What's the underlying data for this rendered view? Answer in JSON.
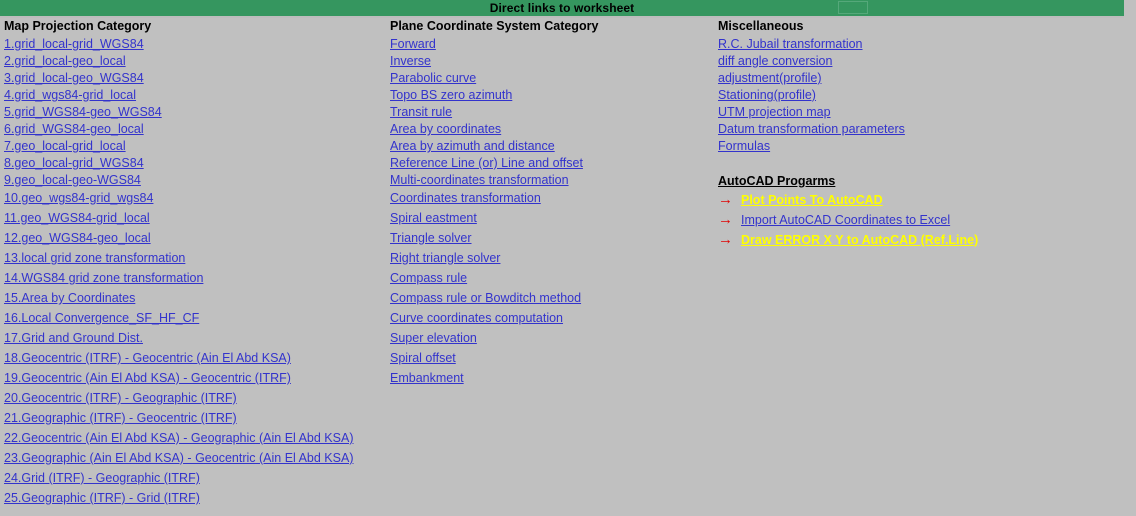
{
  "header": {
    "title": "Direct links to worksheet",
    "banner_color": "#35965f",
    "selection_cell_color": "#55a87a"
  },
  "page": {
    "background_color": "#c0c0c0",
    "link_color": "#3333cc",
    "highlight_link_color": "#ffff00",
    "arrow_color": "#e00000"
  },
  "columns": {
    "map_projection": {
      "title": "Map Projection Category",
      "links": [
        "1.grid_local-grid_WGS84",
        "2.grid_local-geo_local",
        "3.grid_local-geo_WGS84",
        "4.grid_wgs84-grid_local",
        "5.grid_WGS84-geo_WGS84",
        "6.grid_WGS84-geo_local",
        "7.geo_local-grid_local",
        "8.geo_local-grid_WGS84",
        "9.geo_local-geo-WGS84",
        "10.geo_wgs84-grid_wgs84",
        "11.geo_WGS84-grid_local",
        "12.geo_WGS84-geo_local",
        "13.local grid zone transformation",
        "14.WGS84 grid zone transformation",
        "15.Area by Coordinates",
        "16.Local Convergence_SF_HF_CF",
        "17.Grid and Ground Dist.",
        "18.Geocentric (ITRF) - Geocentric (Ain El Abd KSA)",
        "19.Geocentric (Ain El Abd KSA) - Geocentric (ITRF)",
        "20.Geocentric (ITRF) - Geographic (ITRF)",
        "21.Geographic (ITRF) - Geocentric (ITRF)",
        "22.Geocentric (Ain El Abd KSA) - Geographic (Ain El Abd KSA)",
        "23.Geographic (Ain El Abd KSA) - Geocentric (Ain El Abd KSA)",
        "24.Grid (ITRF) - Geographic (ITRF)",
        "25.Geographic (ITRF) - Grid (ITRF)"
      ]
    },
    "plane_coordinate_system": {
      "title": "Plane Coordinate System Category",
      "links": [
        "Forward",
        "Inverse",
        "Parabolic curve",
        "Topo BS zero azimuth",
        "Transit rule",
        "Area by coordinates",
        "Area by azimuth and distance",
        "Reference Line (or) Line and offset",
        "Multi-coordinates transformation",
        "Coordinates transformation",
        "Spiral eastment",
        "Triangle solver",
        "Right triangle solver",
        "Compass rule",
        "Compass rule or Bowditch method",
        "Curve coordinates computation",
        "Super elevation",
        "Spiral offset",
        "Embankment"
      ]
    },
    "miscellaneous": {
      "title": "Miscellaneous",
      "links": [
        "R.C. Jubail transformation",
        "diff angle conversion",
        "adjustment(profile)",
        "Stationing(profile)",
        "UTM projection map",
        "Datum transformation parameters",
        "Formulas"
      ]
    }
  },
  "autocad": {
    "title": "AutoCAD Progarms",
    "arrow_glyph": "→",
    "items": [
      {
        "label": "Plot Points To AutoCAD",
        "style": "yellow"
      },
      {
        "label": "Import AutoCAD Coordinates to Excel",
        "style": "blue"
      },
      {
        "label": "Draw ERROR X Y to AutoCAD (Ref.Line)",
        "style": "yellow"
      }
    ]
  }
}
